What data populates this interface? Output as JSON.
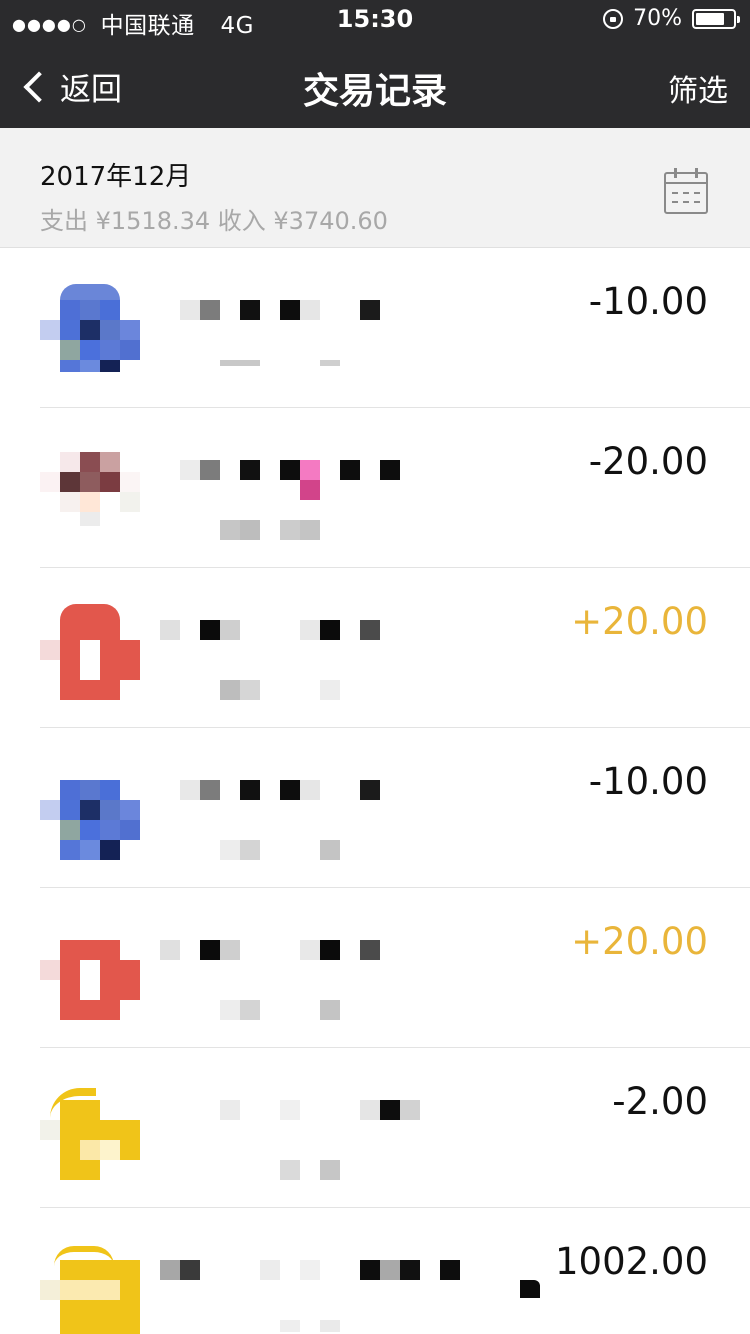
{
  "status_bar": {
    "signal": "●●●●○",
    "carrier": "中国联通",
    "network": "4G",
    "time": "15:30",
    "battery": "70%"
  },
  "nav": {
    "back_label": "返回",
    "title": "交易记录",
    "filter_label": "筛选"
  },
  "summary": {
    "month": "2017年12月",
    "totals": "支出 ¥1518.34 收入 ¥3740.60"
  },
  "colors": {
    "income": "#e9b53a",
    "expense": "#111111",
    "nav_bg": "#2b2b2d"
  },
  "transactions": [
    {
      "amount": "-10.00",
      "type": "expense",
      "avatar_icon": "blue-mosaic-avatar-icon"
    },
    {
      "amount": "-20.00",
      "type": "expense",
      "avatar_icon": "brown-mosaic-avatar-icon"
    },
    {
      "amount": "+20.00",
      "type": "income",
      "avatar_icon": "red-mosaic-avatar-icon"
    },
    {
      "amount": "-10.00",
      "type": "expense",
      "avatar_icon": "blue-mosaic-avatar-icon"
    },
    {
      "amount": "+20.00",
      "type": "income",
      "avatar_icon": "red-mosaic-avatar-icon"
    },
    {
      "amount": "-2.00",
      "type": "expense",
      "avatar_icon": "yellow-mosaic-avatar-icon"
    },
    {
      "amount": "1002.00",
      "type": "expense",
      "avatar_icon": "yellow-mosaic-avatar-icon"
    }
  ]
}
